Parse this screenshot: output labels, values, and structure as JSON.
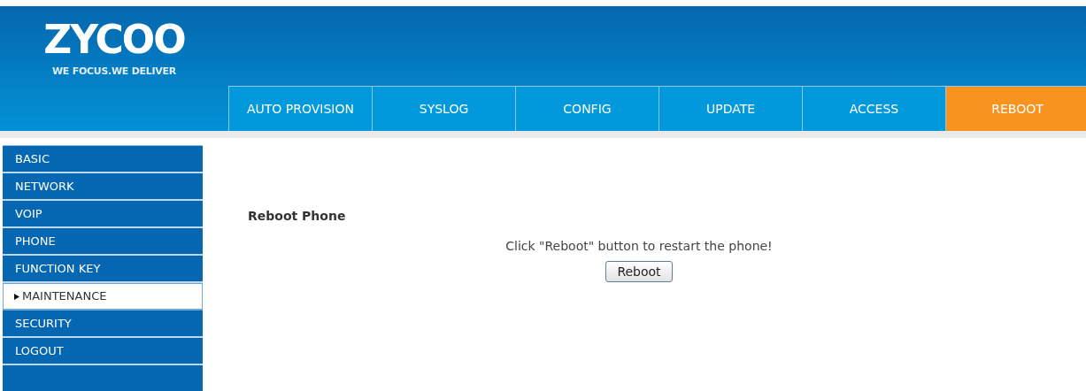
{
  "logo": {
    "name": "ZYCOO",
    "tagline": "WE FOCUS.WE DELIVER"
  },
  "tabs": [
    {
      "label": "AUTO PROVISION",
      "selected": false
    },
    {
      "label": "SYSLOG",
      "selected": false
    },
    {
      "label": "CONFIG",
      "selected": false
    },
    {
      "label": "UPDATE",
      "selected": false
    },
    {
      "label": "ACCESS",
      "selected": false
    },
    {
      "label": "REBOOT",
      "selected": true
    }
  ],
  "sidebar": {
    "items": [
      {
        "label": "BASIC",
        "selected": false
      },
      {
        "label": "NETWORK",
        "selected": false
      },
      {
        "label": "VOIP",
        "selected": false
      },
      {
        "label": "PHONE",
        "selected": false
      },
      {
        "label": "FUNCTION KEY",
        "selected": false
      },
      {
        "label": "MAINTENANCE",
        "selected": true
      },
      {
        "label": "SECURITY",
        "selected": false
      },
      {
        "label": "LOGOUT",
        "selected": false
      }
    ]
  },
  "content": {
    "heading": "Reboot Phone",
    "message": "Click \"Reboot\" button to restart the phone!",
    "button": "Reboot"
  }
}
